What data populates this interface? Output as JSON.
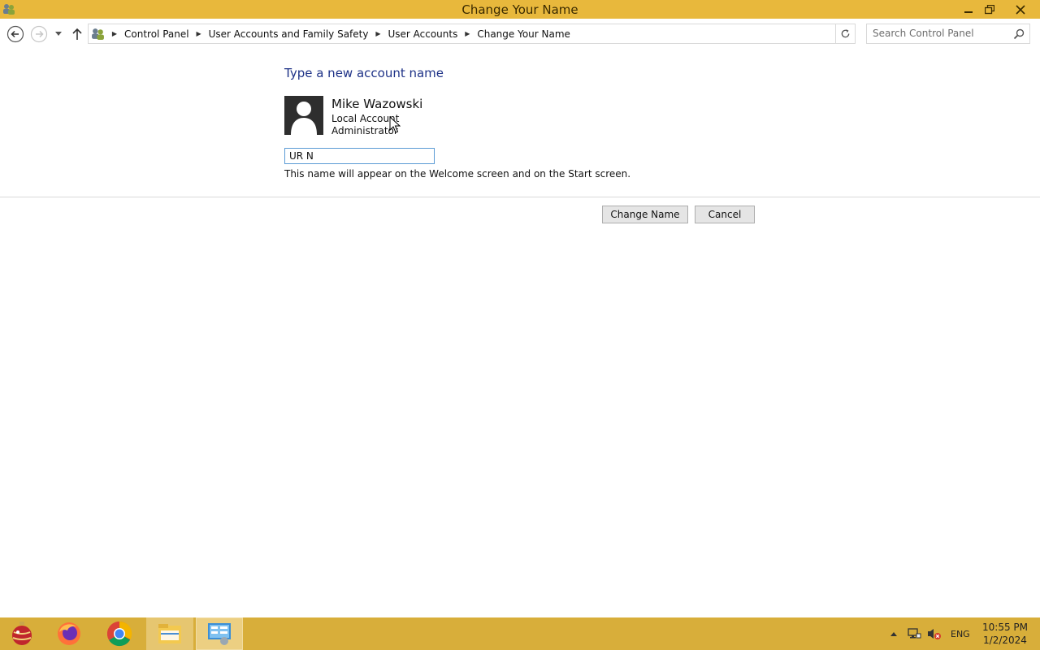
{
  "window": {
    "title": "Change Your Name"
  },
  "address": {
    "breadcrumbs": [
      "Control Panel",
      "User Accounts and Family Safety",
      "User Accounts",
      "Change Your Name"
    ],
    "search_placeholder": "Search Control Panel"
  },
  "main": {
    "heading": "Type a new account name",
    "user": {
      "name": "Mike Wazowski",
      "account_type": "Local Account",
      "role": "Administrator"
    },
    "name_input_value": "UR N",
    "hint": "This name will appear on the Welcome screen and on the Start screen.",
    "change_button": "Change Name",
    "cancel_button": "Cancel"
  },
  "taskbar": {
    "language": "ENG",
    "time": "10:55 PM",
    "date": "1/2/2024"
  },
  "colors": {
    "title_bar": "#e8b83c",
    "taskbar": "#d8ae3a",
    "heading": "#1e3287",
    "input_focus": "#5b9bd5"
  }
}
